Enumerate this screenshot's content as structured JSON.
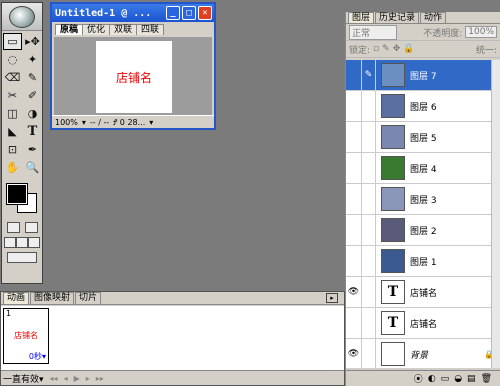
{
  "toolbox": {
    "tools": [
      "▭",
      "▸✥",
      "◌",
      "✦",
      "⌫",
      "✎",
      "✂",
      "✐",
      "◫",
      "◑",
      "◣",
      "T",
      "⊡",
      "✒",
      "✋",
      "🔍"
    ],
    "text_tool": "T"
  },
  "document": {
    "title": "Untitled-1 @ ...",
    "tabs": [
      "原稿",
      "优化",
      "双联",
      "四联"
    ],
    "canvas_text": "店铺名",
    "status": [
      "100%",
      "▾",
      "-- / --",
      "Ꝭ 0 28...",
      "▾"
    ]
  },
  "animation": {
    "tabs": [
      "动画",
      "图像映射",
      "切片"
    ],
    "frame_number": "1",
    "frame_text": "店铺名",
    "frame_delay": "0秒▾",
    "loop": "一直有效▾",
    "controls": [
      "◂◂",
      "◂",
      "▶",
      "▸",
      "▸▸"
    ]
  },
  "layers_panel": {
    "tabs": [
      "图层",
      "历史记录",
      "动作"
    ],
    "blend_mode": "正常",
    "opacity_label": "不透明度:",
    "opacity_value": "100%",
    "lock_label": "锁定:",
    "unify_label": "统一:",
    "layers": [
      {
        "name": "图层 7",
        "thumb": "#6a8fc0",
        "active": true
      },
      {
        "name": "图层 6",
        "thumb": "#5a6fa0"
      },
      {
        "name": "图层 5",
        "thumb": "#7a88b0"
      },
      {
        "name": "图层 4",
        "thumb": "#3a7a30"
      },
      {
        "name": "图层 3",
        "thumb": "#8a96b8"
      },
      {
        "name": "图层 2",
        "thumb": "#5a5a7a"
      },
      {
        "name": "图层 1",
        "thumb": "#3a5a90"
      },
      {
        "name": "店铺名",
        "thumb": "T",
        "visible": true
      },
      {
        "name": "店铺名",
        "thumb": "T"
      },
      {
        "name": "背景",
        "thumb": "W",
        "visible": true,
        "locked": true
      }
    ],
    "bottom_icons": [
      "⦿",
      "◐",
      "▭",
      "◒",
      "▤",
      "🗑"
    ]
  }
}
